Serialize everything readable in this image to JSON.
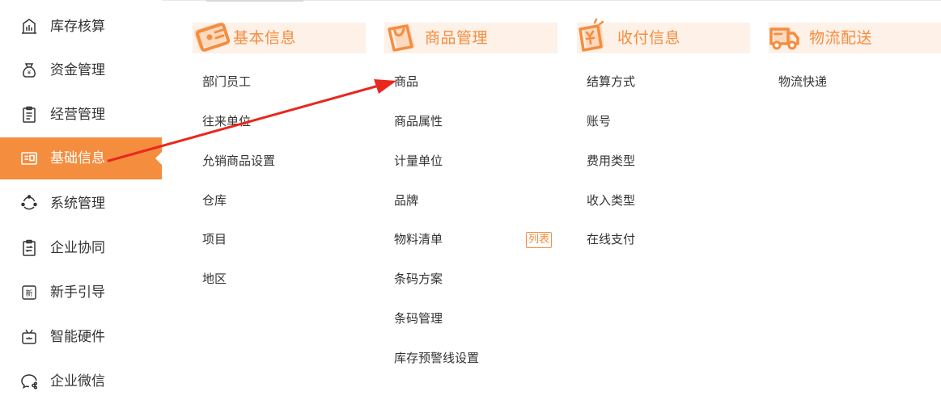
{
  "sidebar": {
    "items": [
      {
        "label": "库存核算",
        "icon": "calculator-icon"
      },
      {
        "label": "资金管理",
        "icon": "money-bag-icon"
      },
      {
        "label": "经营管理",
        "icon": "clipboard-icon"
      },
      {
        "label": "基础信息",
        "icon": "id-card-icon",
        "active": true
      },
      {
        "label": "系统管理",
        "icon": "settings-network-icon"
      },
      {
        "label": "企业协同",
        "icon": "collaboration-icon"
      },
      {
        "label": "新手引导",
        "icon": "new-badge-icon"
      },
      {
        "label": "智能硬件",
        "icon": "device-icon"
      },
      {
        "label": "企业微信",
        "icon": "wechat-work-icon"
      }
    ]
  },
  "menu": {
    "columns": [
      {
        "title": "基本信息",
        "icon": "id-card-icon",
        "items": [
          "部门员工",
          "往来单位",
          "允销商品设置",
          "仓库",
          "项目",
          "地区"
        ]
      },
      {
        "title": "商品管理",
        "icon": "shopping-bag-icon",
        "items": [
          "商品",
          "商品属性",
          "计量单位",
          "品牌",
          "物料清单",
          "条码方案",
          "条码管理",
          "库存预警线设置"
        ],
        "tag": "列表"
      },
      {
        "title": "收付信息",
        "icon": "receipt-icon",
        "items": [
          "结算方式",
          "账号",
          "费用类型",
          "收入类型",
          "在线支付"
        ]
      },
      {
        "title": "物流配送",
        "icon": "delivery-truck-icon",
        "items": [
          "物流快递"
        ]
      }
    ]
  },
  "colors": {
    "accent": "#f58d3f",
    "header_bg": "#fdf1e8",
    "annotation_arrow": "#e8281e"
  }
}
